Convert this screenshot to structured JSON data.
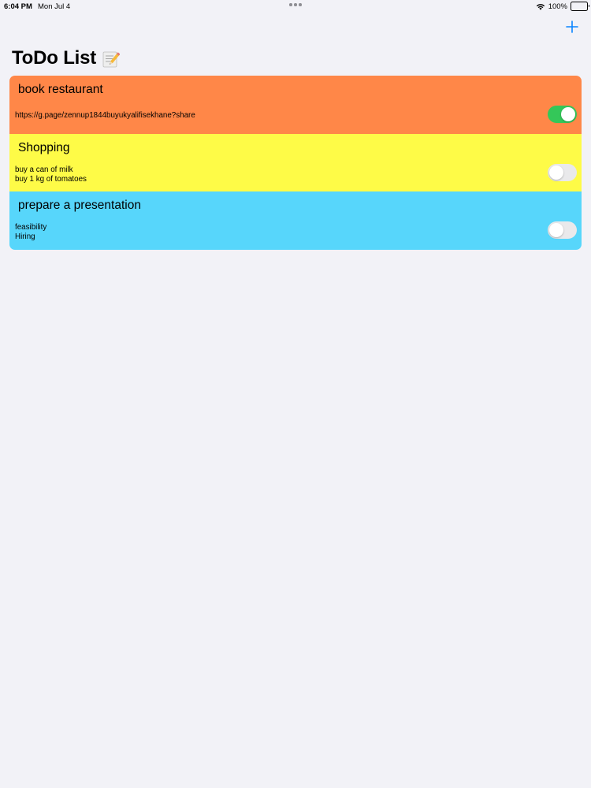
{
  "status_bar": {
    "time": "6:04 PM",
    "date": "Mon Jul 4",
    "battery": "100%"
  },
  "nav": {
    "add_icon": "plus-icon"
  },
  "page": {
    "title": "ToDo List",
    "title_icon": "memo-icon"
  },
  "colors": {
    "accent": "#0a84ff",
    "toggle_on": "#34c759",
    "toggle_off": "#e9e9eb"
  },
  "todos": [
    {
      "title": "book restaurant",
      "lines": [
        "https://g.page/zennup1844buyukyalifisekhane?share"
      ],
      "color": "#ff8748",
      "done": true
    },
    {
      "title": "Shopping",
      "lines": [
        "buy a can of milk",
        "buy 1 kg of tomatoes"
      ],
      "color": "#fefb47",
      "done": false
    },
    {
      "title": "prepare a presentation",
      "lines": [
        "feasibility",
        "Hiring"
      ],
      "color": "#57d6fb",
      "done": false
    }
  ]
}
